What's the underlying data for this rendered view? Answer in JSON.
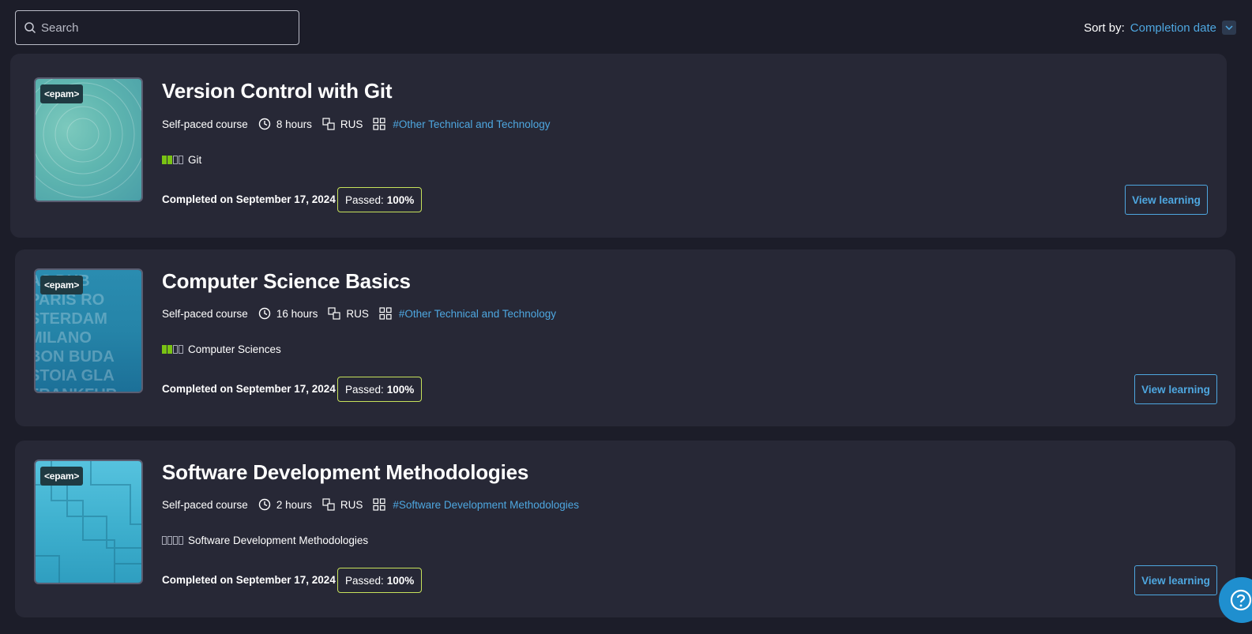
{
  "search": {
    "placeholder": "Search"
  },
  "sort": {
    "label": "Sort by:",
    "value": "Completion date"
  },
  "courses": [
    {
      "title": "Version Control with Git",
      "type": "Self-paced course",
      "duration": "8 hours",
      "language": "RUS",
      "tag": "#Other Technical and Technology",
      "skill": "Git",
      "skill_level": 2,
      "completed": "Completed on September 17, 2024",
      "passed_label": "Passed:",
      "passed_value": "100%",
      "button": "View learning",
      "logo": "<epam>",
      "accent": "#5fb6b0"
    },
    {
      "title": "Computer Science Basics",
      "type": "Self-paced course",
      "duration": "16 hours",
      "language": "RUS",
      "tag": "#Other Technical and Technology",
      "skill": "Computer Sciences",
      "skill_level": 2,
      "completed": "Completed on September 17, 2024",
      "passed_label": "Passed:",
      "passed_value": "100%",
      "button": "View learning",
      "logo": "<epam>",
      "accent": "#2584a8"
    },
    {
      "title": "Software Development Methodologies",
      "type": "Self-paced course",
      "duration": "2 hours",
      "language": "RUS",
      "tag": "#Software Development Methodologies",
      "skill": "Software Development Methodologies",
      "skill_level": 0,
      "completed": "Completed on September 17, 2024",
      "passed_label": "Passed:",
      "passed_value": "100%",
      "button": "View learning",
      "logo": "<epam>",
      "accent": "#3fb1cf"
    }
  ],
  "colors": {
    "background": "#1c1d29",
    "card": "#272836",
    "link": "#4ea7e0",
    "skill_on": "#7ac314",
    "passed_border": "#c7e25b",
    "help": "#1f8fcf"
  },
  "icons": {
    "search": "search-icon",
    "sort": "chevron-down-icon",
    "duration": "clock-icon",
    "language": "translate-icon",
    "tag": "grid-icon",
    "help": "question-icon"
  }
}
